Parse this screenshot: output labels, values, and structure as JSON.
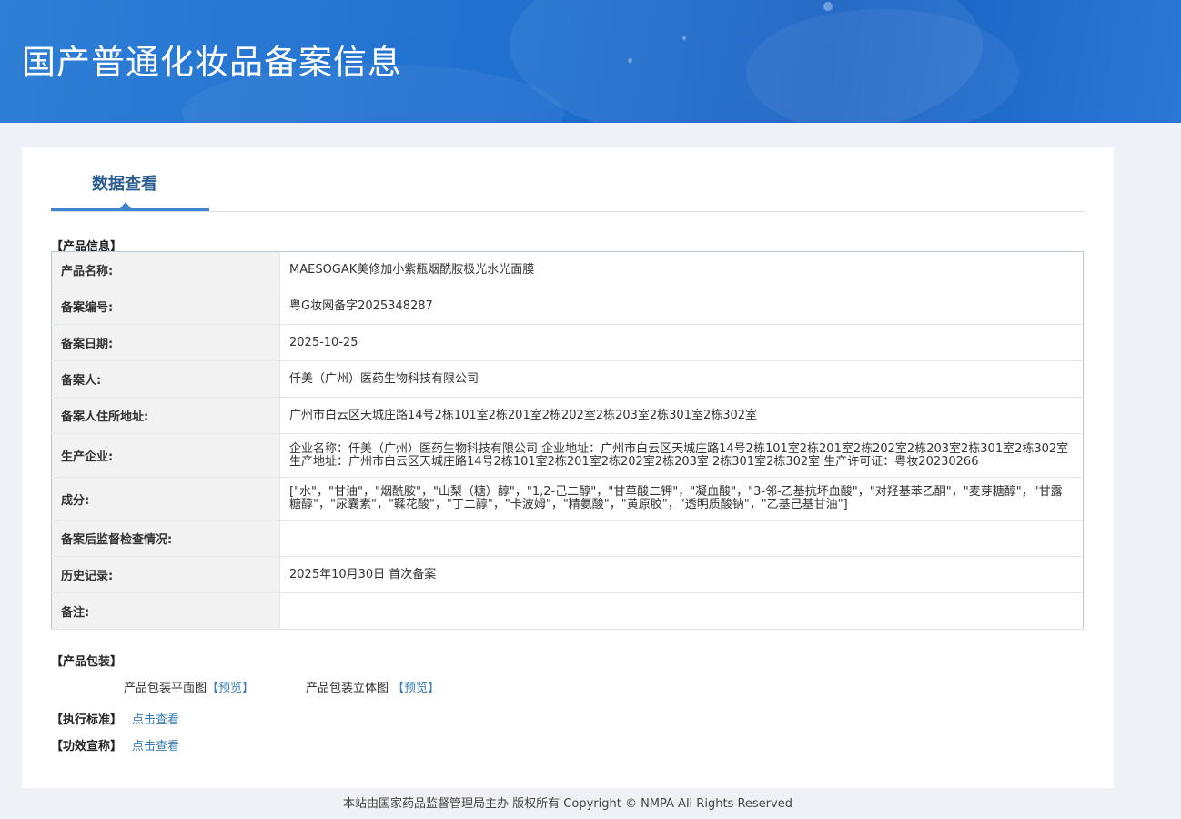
{
  "header": {
    "title": "国产普通化妆品备案信息"
  },
  "tabs": [
    {
      "label": "数据查看"
    }
  ],
  "product_info": {
    "section_title": "【产品信息】",
    "rows": [
      {
        "label": "产品名称:",
        "value": "MAESOGAK美修加小紫瓶烟酰胺极光水光面膜"
      },
      {
        "label": "备案编号:",
        "value": "粤G妆网备字2025348287"
      },
      {
        "label": "备案日期:",
        "value": "2025-10-25"
      },
      {
        "label": "备案人:",
        "value": "仟美（广州）医药生物科技有限公司"
      },
      {
        "label": "备案人住所地址:",
        "value": "广州市白云区天城庄路14号2栋101室2栋201室2栋202室2栋203室2栋301室2栋302室"
      },
      {
        "label": "生产企业:",
        "value": "企业名称：仟美（广州）医药生物科技有限公司 企业地址：广州市白云区天城庄路14号2栋101室2栋201室2栋202室2栋203室2栋301室2栋302室 生产地址：广州市白云区天城庄路14号2栋101室2栋201室2栋202室2栋203室 2栋301室2栋302室 生产许可证：粤妆20230266"
      },
      {
        "label": "成分:",
        "value": "[\"水\"，\"甘油\"，\"烟酰胺\"，\"山梨（糖）醇\"，\"1,2-己二醇\"，\"甘草酸二钾\"，\"凝血酸\"，\"3-邻-乙基抗坏血酸\"，\"对羟基苯乙酮\"，\"麦芽糖醇\"，\"甘露糖醇\"，\"尿囊素\"，\"鞣花酸\"，\"丁二醇\"，\"卡波姆\"，\"精氨酸\"，\"黄原胶\"，\"透明质酸钠\"，\"乙基己基甘油\"]"
      },
      {
        "label": "备案后监督检查情况:",
        "value": ""
      },
      {
        "label": "历史记录:",
        "value": "2025年10月30日 首次备案"
      },
      {
        "label": "备注:",
        "value": ""
      }
    ]
  },
  "packaging": {
    "section_title": "【产品包装】",
    "flat_label": "产品包装平面图",
    "flat_preview": "【预览】",
    "solid_label": "产品包装立体图",
    "solid_preview": "【预览】"
  },
  "standard": {
    "section_title": "【执行标准】",
    "link": "点击查看"
  },
  "efficacy": {
    "section_title": "【功效宣称】",
    "link": "点击查看"
  },
  "footer": {
    "text": "本站由国家药品监督管理局主办 版权所有 Copyright © NMPA All Rights Reserved"
  }
}
